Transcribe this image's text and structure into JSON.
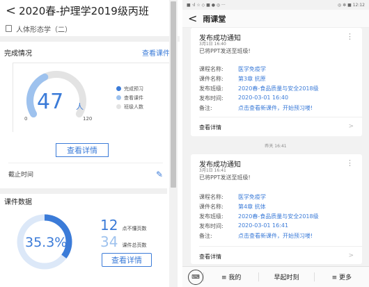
{
  "left": {
    "back_glyph": "<",
    "title": "2020春-护理学2019级丙班",
    "subtitle": "人体形态学（二）",
    "completion": {
      "heading": "完成情况",
      "view_link": "查看课件",
      "big_number": "47",
      "unit": "人",
      "tick_min": "0",
      "tick_max": "120",
      "gauge_value": 47,
      "gauge_max": 120,
      "legend": [
        {
          "label": "完成预习",
          "color": "#3b7bd8"
        },
        {
          "label": "查看课件",
          "color": "#9ec2ee"
        },
        {
          "label": "班级人数",
          "color": "#e3e3e3"
        }
      ],
      "detail_button": "查看详情",
      "deadline_label": "截止时间"
    },
    "courseware": {
      "heading": "课件数据",
      "percent": "35.3%",
      "percent_value": 0.353,
      "stat1_value": "12",
      "stat1_label": "点不懂页数",
      "stat2_value": "34",
      "stat2_label": "课件总页数",
      "detail_button": "查看详情"
    }
  },
  "right": {
    "status_left": "■ ᐧıl ☆ ◇ ■ ● ◎ ···",
    "status_right": "◎ ✻ ■ 12:12",
    "app_title": "雨课堂",
    "cards": [
      {
        "title": "发布成功通知",
        "date": "3月1日 16:40",
        "message": "已将PPT发送至班级!",
        "rows": [
          {
            "k": "课程名称:",
            "v": "医学免疫学"
          },
          {
            "k": "课件名称:",
            "v": "第3章 抗原"
          },
          {
            "k": "发布班级:",
            "v": "2020春-食品质量与安全2018级"
          },
          {
            "k": "发布时间:",
            "v": "2020-03-01 16:40"
          },
          {
            "k": "备注:",
            "v": "点击查看新课件，开始预习喽!"
          }
        ],
        "view_detail": "查看详情"
      },
      {
        "title": "发布成功通知",
        "date": "3月1日 16:41",
        "message": "已将PPT发送至班级!",
        "rows": [
          {
            "k": "课程名称:",
            "v": "医学免疫学"
          },
          {
            "k": "课件名称:",
            "v": "第4章 抗体"
          },
          {
            "k": "发布班级:",
            "v": "2020春-食品质量与安全2018级"
          },
          {
            "k": "发布时间:",
            "v": "2020-03-01 16:41"
          },
          {
            "k": "备注:",
            "v": "点击查看新课件，开始预习喽!"
          }
        ],
        "view_detail": "查看详情"
      }
    ],
    "time_divider": "昨天 16:41",
    "bottom": [
      "≡ 我的",
      "早起时刻",
      "≡ 更多"
    ],
    "more_glyph": "⋮",
    "arrow_glyph": ">"
  }
}
